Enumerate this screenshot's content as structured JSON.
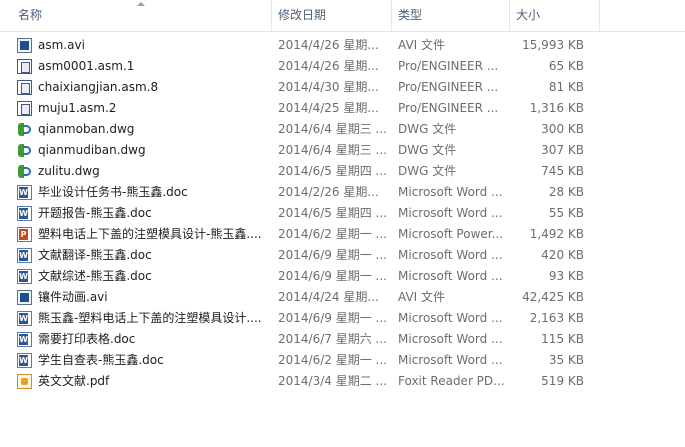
{
  "columns": {
    "name": "名称",
    "date": "修改日期",
    "type": "类型",
    "size": "大小"
  },
  "files": [
    {
      "icon": "avi-video-icon",
      "kind": "avi",
      "name": "asm.avi",
      "date": "2014/4/26 星期...",
      "type": "AVI 文件",
      "size": "15,993 KB"
    },
    {
      "icon": "proe-file-icon",
      "kind": "asm",
      "name": "asm0001.asm.1",
      "date": "2014/4/26 星期...",
      "type": "Pro/ENGINEER ...",
      "size": "65 KB"
    },
    {
      "icon": "proe-file-icon",
      "kind": "asm",
      "name": "chaixiangjian.asm.8",
      "date": "2014/4/30 星期...",
      "type": "Pro/ENGINEER ...",
      "size": "81 KB"
    },
    {
      "icon": "proe-file-icon",
      "kind": "asm",
      "name": "muju1.asm.2",
      "date": "2014/4/25 星期...",
      "type": "Pro/ENGINEER ...",
      "size": "1,316 KB"
    },
    {
      "icon": "dwg-file-icon",
      "kind": "dwg",
      "name": "qianmoban.dwg",
      "date": "2014/6/4 星期三 ...",
      "type": "DWG 文件",
      "size": "300 KB"
    },
    {
      "icon": "dwg-file-icon",
      "kind": "dwg",
      "name": "qianmudiban.dwg",
      "date": "2014/6/4 星期三 ...",
      "type": "DWG 文件",
      "size": "307 KB"
    },
    {
      "icon": "dwg-file-icon",
      "kind": "dwg",
      "name": "zulitu.dwg",
      "date": "2014/6/5 星期四 ...",
      "type": "DWG 文件",
      "size": "745 KB"
    },
    {
      "icon": "word-doc-icon",
      "kind": "doc",
      "name": "毕业设计任务书-熊玉鑫.doc",
      "date": "2014/2/26 星期...",
      "type": "Microsoft Word ...",
      "size": "28 KB"
    },
    {
      "icon": "word-doc-icon",
      "kind": "doc",
      "name": "开题报告-熊玉鑫.doc",
      "date": "2014/6/5 星期四 ...",
      "type": "Microsoft Word ...",
      "size": "55 KB"
    },
    {
      "icon": "powerpoint-icon",
      "kind": "ppt",
      "name": "塑料电话上下盖的注塑模具设计-熊玉鑫....",
      "date": "2014/6/2 星期一 ...",
      "type": "Microsoft Power...",
      "size": "1,492 KB"
    },
    {
      "icon": "word-doc-icon",
      "kind": "doc",
      "name": "文献翻译-熊玉鑫.doc",
      "date": "2014/6/9 星期一 ...",
      "type": "Microsoft Word ...",
      "size": "420 KB"
    },
    {
      "icon": "word-doc-icon",
      "kind": "doc",
      "name": "文献综述-熊玉鑫.doc",
      "date": "2014/6/9 星期一 ...",
      "type": "Microsoft Word ...",
      "size": "93 KB"
    },
    {
      "icon": "avi-video-icon",
      "kind": "avi",
      "name": "镶件动画.avi",
      "date": "2014/4/24 星期...",
      "type": "AVI 文件",
      "size": "42,425 KB"
    },
    {
      "icon": "word-doc-icon",
      "kind": "doc",
      "name": "熊玉鑫-塑料电话上下盖的注塑模具设计....",
      "date": "2014/6/9 星期一 ...",
      "type": "Microsoft Word ...",
      "size": "2,163 KB"
    },
    {
      "icon": "word-doc-icon",
      "kind": "doc",
      "name": "需要打印表格.doc",
      "date": "2014/6/7 星期六 ...",
      "type": "Microsoft Word ...",
      "size": "115 KB"
    },
    {
      "icon": "word-doc-icon",
      "kind": "doc",
      "name": "学生自查表-熊玉鑫.doc",
      "date": "2014/6/2 星期一 ...",
      "type": "Microsoft Word ...",
      "size": "35 KB"
    },
    {
      "icon": "pdf-file-icon",
      "kind": "pdf",
      "name": "英文文献.pdf",
      "date": "2014/3/4 星期二 ...",
      "type": "Foxit Reader PD...",
      "size": "519 KB"
    }
  ],
  "colors": {
    "header_text": "#4c607a",
    "meta_text": "#6d6d6d",
    "name_text": "#1e1e1e"
  }
}
